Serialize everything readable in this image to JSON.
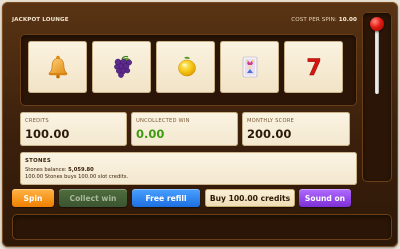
{
  "header": {
    "title": "JACKPOT LOUNGE",
    "cost_label": "COST PER SPIN:",
    "cost_value": "10.00"
  },
  "reels": [
    {
      "symbol": "bell-icon"
    },
    {
      "symbol": "grapes-icon"
    },
    {
      "symbol": "lemon-icon"
    },
    {
      "symbol": "joker-card-icon"
    },
    {
      "symbol": "seven-icon",
      "text": "7"
    }
  ],
  "stats": {
    "credits": {
      "label": "CREDITS",
      "value": "100.00"
    },
    "uncollected": {
      "label": "UNCOLLECTED WIN",
      "value": "0.00",
      "color": "#3e9a12"
    },
    "monthly": {
      "label": "MONTHLY SCORE",
      "value": "200.00"
    }
  },
  "stones": {
    "title": "STONES",
    "balance_label": "Stones balance:",
    "balance_value": "5,059.80",
    "rate_text": "100.00 Stones buys 100.00 slot credits."
  },
  "buttons": {
    "spin": "Spin",
    "collect": "Collect win",
    "refill": "Free refill",
    "buy": "Buy 100.00 credits",
    "sound": "Sound on"
  },
  "colors": {
    "cabinet": "#3b200c",
    "panel": "#fbf4e3",
    "spin": "#f07f00",
    "refill": "#1d6fe0",
    "sound": "#7d2fd6",
    "seven": "#d8140f"
  }
}
